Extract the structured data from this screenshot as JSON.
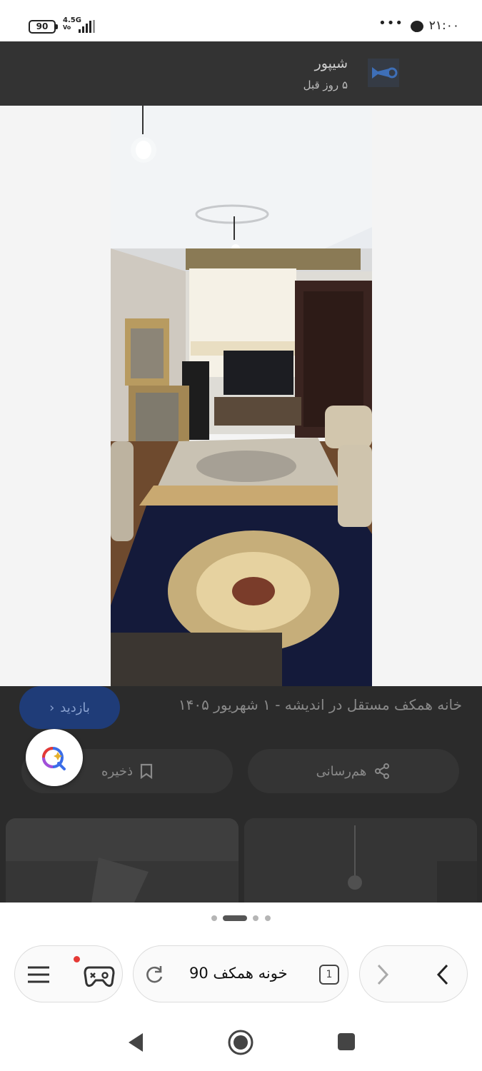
{
  "status_bar": {
    "battery": "90",
    "network": "4.5G",
    "network_sub": "Vo",
    "time": "۲۱:۰۰",
    "dots": "•••"
  },
  "site_header": {
    "name": "شیپور",
    "posted": "۵ روز قبل",
    "logo_icon": "sheypoor-trumpet-icon"
  },
  "listing": {
    "title": "خانه همکف مستقل در اندیشه - ۱ شهریور ۱۴۰۵",
    "visit_label": "بازدید",
    "save_label": "ذخیره",
    "share_label": "هم‌رسانی"
  },
  "pager": {
    "count": 4,
    "active": 1
  },
  "toolbar": {
    "menu_icon": "hamburger-menu-icon",
    "games_icon": "gamepad-icon",
    "reload_icon": "reload-icon",
    "address": "خونه همکف 90",
    "tab_count": "1",
    "forward_icon": "chevron-right-icon",
    "back_icon": "chevron-left-icon"
  },
  "nav": {
    "back": "back-triangle-icon",
    "home": "home-circle-icon",
    "recents": "recents-square-icon"
  },
  "colors": {
    "accent_blue": "#1f3c78",
    "overlay": "#2c2c2c",
    "notif_dot": "#e53935"
  }
}
